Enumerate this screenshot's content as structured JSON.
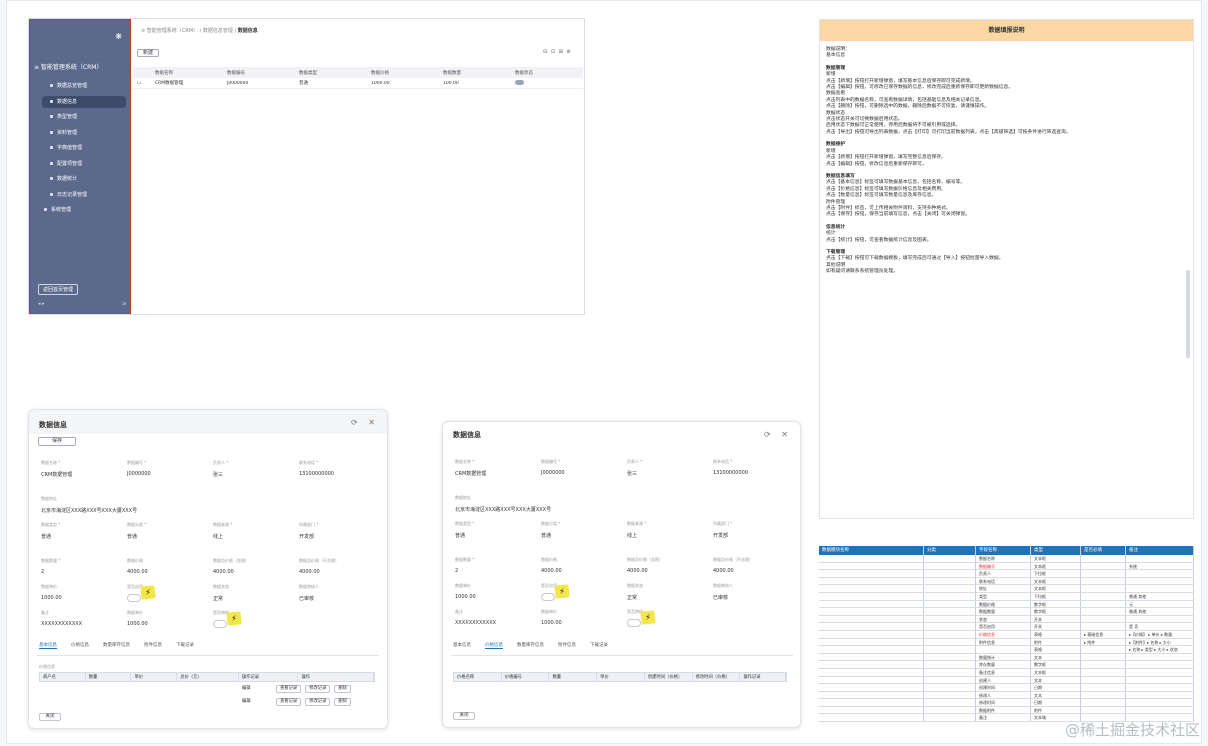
{
  "panel1": {
    "sidebar": {
      "logo": "❋",
      "system_title": "≡ 智能管理系统（CRM）",
      "items": [
        {
          "label": "数据总览管理",
          "active": false
        },
        {
          "label": "数据信息",
          "active": true
        },
        {
          "label": "类型管理",
          "active": false
        },
        {
          "label": "资料管理",
          "active": false
        },
        {
          "label": "字典值管理",
          "active": false
        },
        {
          "label": "配置项管理",
          "active": false
        },
        {
          "label": "数据统计",
          "active": false
        },
        {
          "label": "日志记录管理",
          "active": false
        },
        {
          "label": "系统管理",
          "active": false
        }
      ],
      "bottom_button": "返回首页管理",
      "footer_left": "◂ ▸",
      "footer_right": "⇲"
    },
    "breadcrumb_prefix": "≡  智能管理系统（CRM） / 数据信息管理 /",
    "breadcrumb_current": "数据信息",
    "add_button": "新建",
    "toolbar": "⊟  ⊡  ⊞  ⚙",
    "columns": [
      "",
      "数据名称",
      "数据编号",
      "数据类型",
      "数据价格",
      "数据数量",
      "数据状态"
    ],
    "rows": [
      [
        "",
        "CRM数据管理",
        "J0000000",
        "普通",
        "1000.00",
        "100.00",
        "switch"
      ]
    ]
  },
  "panel2": {
    "title": "数据填报说明",
    "lines": [
      {
        "t": "数据说明：",
        "s": false
      },
      {
        "t": "基本信息",
        "s": false
      },
      {
        "t": "数据管理",
        "s": true
      },
      {
        "t": "    新增",
        "s": false
      },
      {
        "t": "点击【新增】按钮打开新增弹窗，填写基本信息后保存即可完成新增。",
        "s": false
      },
      {
        "t": "点击【编辑】按钮，可修改已保存数据的信息，修改完成后重新保存即可更新数据信息。",
        "s": false
      },
      {
        "t": "    数据查看",
        "s": false
      },
      {
        "t": "点击列表中的数据名称，可查看数据详情，包括基础信息及相关记录信息。",
        "s": false
      },
      {
        "t": "点击【删除】按钮，可删除选中的数据，删除后数据不可恢复，请谨慎操作。",
        "s": false
      },
      {
        "t": "    数据状态",
        "s": false
      },
      {
        "t": "点击状态开关可切换数据启用状态。",
        "s": false
      },
      {
        "t": "启用状态下数据可正常使用，停用后数据将不可被引用或选择。",
        "s": false
      },
      {
        "t": "点击【导出】按钮可导出列表数据，点击【打印】可打印当前数据列表，点击【高级筛选】可按条件进行筛选查询。",
        "s": false
      },
      {
        "t": "数据维护",
        "s": true
      },
      {
        "t": "    新增",
        "s": false
      },
      {
        "t": "点击【新增】按钮打开新增弹窗，填写完整信息后保存。",
        "s": false
      },
      {
        "t": "点击【编辑】按钮，修改信息后重新保存即可。",
        "s": false
      },
      {
        "t": "数据信息填写",
        "s": true
      },
      {
        "t": "点击【基本信息】标签可填写数据基本信息，包括名称、编号等。",
        "s": false
      },
      {
        "t": "点击【价格信息】标签可填写数据价格信息及相关费用。",
        "s": false
      },
      {
        "t": "点击【数量信息】标签可填写数量信息及库存信息。",
        "s": false
      },
      {
        "t": "    附件管理",
        "s": false
      },
      {
        "t": "点击【附件】标签，可上传相关附件资料，支持多种格式。",
        "s": false
      },
      {
        "t": "点击【保存】按钮，保存当前填写信息，点击【关闭】可关闭弹窗。",
        "s": false
      },
      {
        "t": "信息统计",
        "s": true
      },
      {
        "t": "    统计",
        "s": false
      },
      {
        "t": "点击【统计】按钮，可查看数据统计信息及图表。",
        "s": false
      },
      {
        "t": "下载管理",
        "s": true
      },
      {
        "t": "点击【下载】按钮可下载数据模板，填写完成后可通过【导入】按钮批量导入数据。",
        "s": false
      },
      {
        "t": "其他说明",
        "s": false
      },
      {
        "t": "如有疑问请联系系统管理员处理。",
        "s": false
      }
    ]
  },
  "panel3": {
    "headers": [
      "数据模块名称",
      "分类",
      "字段名称",
      "类型",
      "是否必填",
      "备注"
    ],
    "rows": [
      [
        "",
        "",
        "数据名称",
        "文本框",
        "",
        ""
      ],
      [
        "",
        "",
        "数据编号",
        "文本框",
        "",
        "系统"
      ],
      [
        "",
        "",
        "负责人",
        "下拉框",
        "",
        ""
      ],
      [
        "",
        "",
        "联系电话",
        "文本框",
        "",
        ""
      ],
      [
        "",
        "",
        "地址",
        "文本框",
        "",
        ""
      ],
      [
        "",
        "",
        "类型",
        "下拉框",
        "",
        "普通  其他"
      ],
      [
        "",
        "",
        "数据价格",
        "数字框",
        "",
        "元"
      ],
      [
        "",
        "",
        "数据数量",
        "数字框",
        "",
        "普通  其他"
      ],
      [
        "",
        "",
        "状态",
        "开关",
        "",
        ""
      ],
      [
        "",
        "",
        "是否启用",
        "开关",
        "",
        "是  否"
      ],
      [
        "",
        "",
        "价格信息",
        "表格",
        "▸ 基础信息",
        "▸【价格】 ▸ 单价  ▸ 数量"
      ],
      [
        "",
        "",
        "附件信息",
        "附件",
        "▸ 附件",
        "▸【附件】▸ 名称  ▸ 大小"
      ],
      [
        "",
        "",
        "",
        "表格",
        "",
        "▸ 名称 ▸ 类型 ▸ 大小 ▸ 状态"
      ],
      [
        "",
        "",
        "数量统计",
        "文本",
        "",
        ""
      ],
      [
        "",
        "",
        "库存数量",
        "数字框",
        "",
        ""
      ],
      [
        "",
        "",
        "备注信息",
        "文本框",
        "",
        ""
      ],
      [
        "",
        "",
        "创建人",
        "文本",
        "",
        ""
      ],
      [
        "",
        "",
        "创建时间",
        "日期",
        "",
        ""
      ],
      [
        "",
        "",
        "修改人",
        "文本",
        "",
        ""
      ],
      [
        "",
        "",
        "修改时间",
        "日期",
        "",
        ""
      ],
      [
        "",
        "",
        "数据附件",
        "附件",
        "",
        ""
      ],
      [
        "",
        "",
        "备注",
        "文本域",
        "",
        ""
      ]
    ],
    "red_rows": [
      1,
      10
    ]
  },
  "dialog": {
    "title": "数据信息",
    "icons": "⟳ ✕",
    "save": "保存",
    "close": "关闭",
    "fields": [
      {
        "label": "数据名称 *",
        "value": "CRM数据管理"
      },
      {
        "label": "数据编号 *",
        "value": "J0000000"
      },
      {
        "label": "负责人 *",
        "value": "张三"
      },
      {
        "label": "联系电话 *",
        "value": "13100000000"
      },
      {
        "label": "数据地址",
        "value": "北京市海淀区XXX路XXX号XXX大厦XXX号"
      },
      {
        "label": "数据类型 *",
        "value": "普通"
      },
      {
        "label": "数据分类 *",
        "value": "普通"
      },
      {
        "label": "数据来源 *",
        "value": "线上"
      },
      {
        "label": "所属部门 *",
        "value": "开发部"
      },
      {
        "label": "数据数量 *",
        "value": "2"
      },
      {
        "label": "数据价格",
        "value": "4000.00"
      },
      {
        "label": "数据总价格（含税）",
        "value": "4000.00"
      },
      {
        "label": "数据总价格（不含税）",
        "value": "4000.00"
      },
      {
        "label": "数据单价",
        "value": "1000.00"
      },
      {
        "label": "是否启用",
        "value": ""
      },
      {
        "label": "数据状态",
        "value": "正常"
      },
      {
        "label": "数据审核人",
        "value": "已审核"
      },
      {
        "label": "备注",
        "value": "XXXXXXXXXXXX"
      },
      {
        "label": "数据单价",
        "value": "1000.00"
      },
      {
        "label": "是否审核",
        "value": ""
      }
    ],
    "sticker": "⚡",
    "tabs": [
      "基本信息",
      "价格信息",
      "数量库存信息",
      "附件信息",
      "下载记录"
    ],
    "left": {
      "active_tab": 0,
      "sub_label": "价格信息",
      "sub_headers": [
        "商户名",
        "数量",
        "单价",
        "总价（元）",
        "操作记录",
        "操作"
      ],
      "rows": [
        {
          "c": "编辑",
          "b1": "查看记录",
          "b2": "修改记录",
          "b3": "删除"
        },
        {
          "c": "编辑",
          "b1": "查看记录",
          "b2": "修改记录",
          "b3": "删除"
        }
      ]
    },
    "right": {
      "active_tab": 1,
      "sub_headers": [
        "价格名称",
        "价格编号",
        "数量",
        "单价",
        "创建时间（价格）",
        "修改时间（价格）",
        "操作记录"
      ]
    }
  },
  "watermark": "@稀土掘金技术社区"
}
